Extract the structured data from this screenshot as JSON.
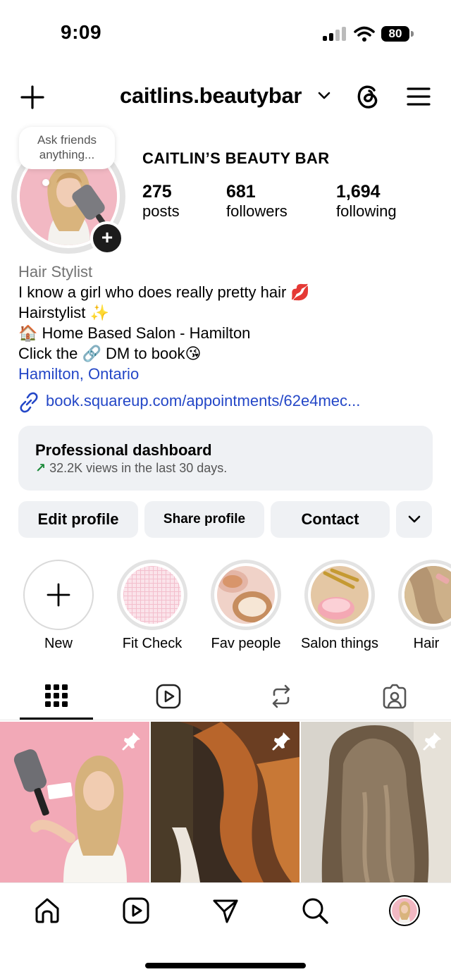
{
  "status_bar": {
    "time": "9:09",
    "battery": "80"
  },
  "header": {
    "username": "caitlins.beautybar",
    "create_icon": "plus-icon",
    "threads_icon": "threads-icon",
    "menu_icon": "hamburger-menu-icon"
  },
  "profile": {
    "note_bubble": "Ask friends anything...",
    "full_name": "CAITLIN’S BEAUTY BAR",
    "stats": [
      {
        "value": "275",
        "label": "posts"
      },
      {
        "value": "681",
        "label": "followers"
      },
      {
        "value": "1,694",
        "label": "following"
      }
    ]
  },
  "bio": {
    "category": "Hair Stylist",
    "line1": "I know a girl who does really pretty hair 💋",
    "line2": "Hairstylist ✨",
    "line3": "🏠 Home Based Salon - Hamilton",
    "line4": "Click the 🔗 DM to book😘",
    "location": "Hamilton, Ontario",
    "link": "book.squareup.com/appointments/62e4mec..."
  },
  "dashboard": {
    "title": "Professional dashboard",
    "arrow": "↗",
    "subtitle": "32.2K views in the last 30 days."
  },
  "buttons": {
    "edit": "Edit profile",
    "share": "Share profile",
    "contact": "Contact"
  },
  "highlights": [
    {
      "label": "New"
    },
    {
      "label": "Fit Check"
    },
    {
      "label": "Fav people"
    },
    {
      "label": "Salon things"
    },
    {
      "label": "Hair"
    }
  ],
  "tabs": [
    "grid-icon",
    "reels-icon",
    "reposts-icon",
    "tagged-icon"
  ],
  "nav": [
    "home-icon",
    "reels-icon",
    "messages-icon",
    "search-icon",
    "profile-avatar"
  ],
  "colors": {
    "link": "#2447c7",
    "button_bg": "#eff1f4",
    "trend_green": "#1b8a3a"
  }
}
